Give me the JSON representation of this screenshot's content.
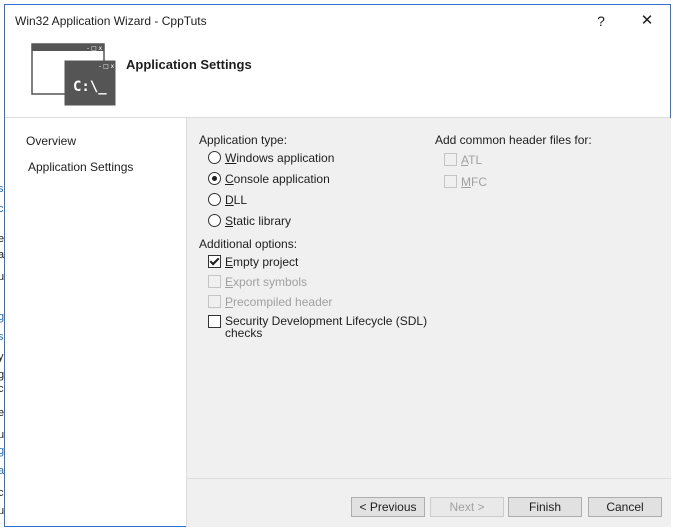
{
  "window": {
    "title": "Win32 Application Wizard - CppTuts",
    "help_glyph": "?",
    "close_glyph": "✕"
  },
  "header": {
    "title": "Application Settings",
    "icon_prompt": "C:\\_",
    "icon_dots": "- □ x"
  },
  "sidebar": {
    "items": [
      {
        "label": "Overview"
      },
      {
        "label": "Application Settings"
      }
    ]
  },
  "app_type": {
    "label": "Application type:",
    "options": [
      {
        "pre": "",
        "key": "W",
        "post": "indows application",
        "selected": false
      },
      {
        "pre": "",
        "key": "C",
        "post": "onsole application",
        "selected": true
      },
      {
        "pre": "",
        "key": "D",
        "post": "LL",
        "selected": false
      },
      {
        "pre": "",
        "key": "S",
        "post": "tatic library",
        "selected": false
      }
    ]
  },
  "additional": {
    "label": "Additional options:",
    "options": [
      {
        "pre": "",
        "key": "E",
        "post": "mpty project",
        "checked": true,
        "enabled": true
      },
      {
        "pre": "",
        "key": "E",
        "post": "xport symbols",
        "checked": false,
        "enabled": false
      },
      {
        "pre": "",
        "key": "P",
        "post": "recompiled header",
        "checked": false,
        "enabled": false
      },
      {
        "line1": "Security Development Lifecycle (SDL)",
        "line2": "checks",
        "checked": false,
        "enabled": true
      }
    ]
  },
  "headers": {
    "label": "Add common header files for:",
    "options": [
      {
        "pre": "",
        "key": "A",
        "post": "TL",
        "checked": false,
        "enabled": false
      },
      {
        "pre": "",
        "key": "M",
        "post": "FC",
        "checked": false,
        "enabled": false
      }
    ]
  },
  "buttons": {
    "previous": "< Previous",
    "next": "Next >",
    "finish": "Finish",
    "cancel": "Cancel"
  },
  "background_fragments": [
    "s",
    "c",
    "l",
    "e",
    "a",
    "u",
    "g",
    "s",
    "y",
    "g",
    "c",
    "e",
    "u",
    "g",
    "a",
    "c",
    "u"
  ]
}
